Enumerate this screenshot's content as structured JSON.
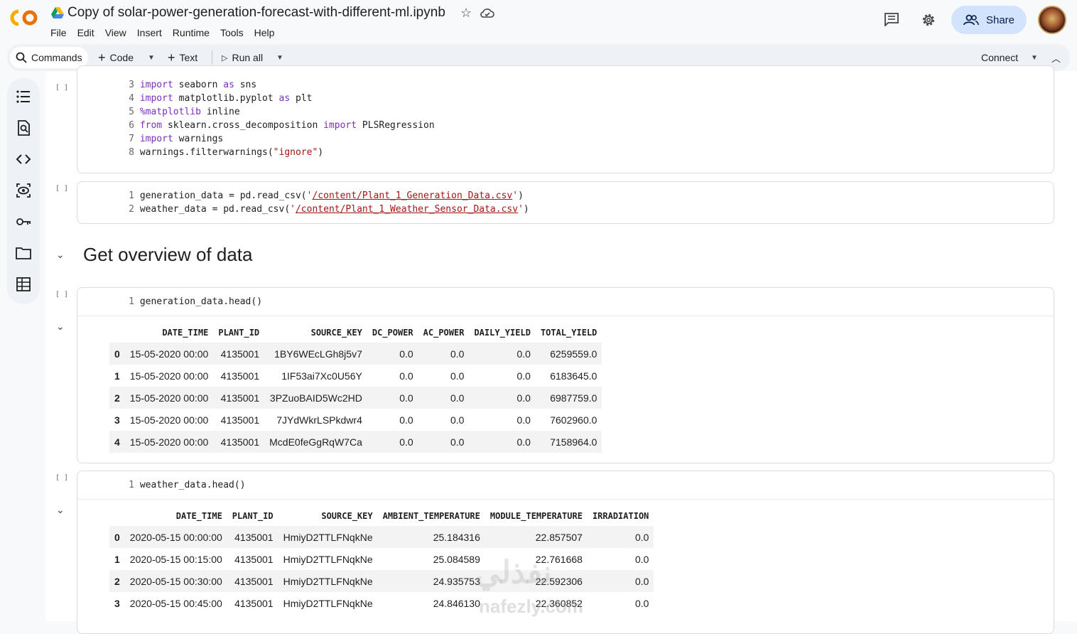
{
  "app": {
    "logo_text": "CO",
    "title": "Copy of solar-power-generation-forecast-with-different-ml.ipynb",
    "menu": [
      "File",
      "Edit",
      "View",
      "Insert",
      "Runtime",
      "Tools",
      "Help"
    ],
    "share_label": "Share"
  },
  "toolbar": {
    "commands_label": "Commands",
    "code_label": "Code",
    "text_label": "Text",
    "run_all_label": "Run all",
    "connect_label": "Connect"
  },
  "cells": {
    "cell1": {
      "bracket": "[ ]",
      "lines": [
        {
          "n": "3",
          "parts": [
            [
              "kw",
              "import"
            ],
            [
              "",
              " seaborn "
            ],
            [
              "kw",
              "as"
            ],
            [
              "",
              " sns"
            ]
          ]
        },
        {
          "n": "4",
          "parts": [
            [
              "kw",
              "import"
            ],
            [
              "",
              " matplotlib.pyplot "
            ],
            [
              "kw",
              "as"
            ],
            [
              "",
              " plt"
            ]
          ]
        },
        {
          "n": "5",
          "parts": [
            [
              "kw",
              "%matplotlib"
            ],
            [
              "",
              " inline"
            ]
          ]
        },
        {
          "n": "6",
          "parts": [
            [
              "kw",
              "from"
            ],
            [
              "",
              " sklearn.cross_decomposition "
            ],
            [
              "kw",
              "import"
            ],
            [
              "",
              " PLSRegression"
            ]
          ]
        },
        {
          "n": "7",
          "parts": [
            [
              "kw",
              "import"
            ],
            [
              "",
              " warnings"
            ]
          ]
        },
        {
          "n": "8",
          "parts": [
            [
              "",
              "warnings.filterwarnings("
            ],
            [
              "str",
              "\"ignore\""
            ],
            [
              "",
              ")"
            ]
          ]
        }
      ]
    },
    "cell2": {
      "bracket": "[ ]",
      "lines": [
        {
          "n": "1",
          "parts": [
            [
              "",
              "generation_data = pd.read_csv("
            ],
            [
              "str",
              "'"
            ],
            [
              "strp",
              "/content/Plant_1_Generation_Data.csv"
            ],
            [
              "str",
              "'"
            ],
            [
              "",
              ")"
            ]
          ]
        },
        {
          "n": "2",
          "parts": [
            [
              "",
              "weather_data = pd.read_csv("
            ],
            [
              "str",
              "'"
            ],
            [
              "strp",
              "/content/Plant_1_Weather_Sensor_Data.csv"
            ],
            [
              "str",
              "'"
            ],
            [
              "",
              ")"
            ]
          ]
        }
      ]
    },
    "heading": "Get overview of data",
    "cell3": {
      "bracket": "[ ]",
      "code_line_no": "1",
      "code": "generation_data.head()",
      "table": {
        "columns": [
          "",
          "DATE_TIME",
          "PLANT_ID",
          "SOURCE_KEY",
          "DC_POWER",
          "AC_POWER",
          "DAILY_YIELD",
          "TOTAL_YIELD"
        ],
        "rows": [
          [
            "0",
            "15-05-2020 00:00",
            "4135001",
            "1BY6WEcLGh8j5v7",
            "0.0",
            "0.0",
            "0.0",
            "6259559.0"
          ],
          [
            "1",
            "15-05-2020 00:00",
            "4135001",
            "1IF53ai7Xc0U56Y",
            "0.0",
            "0.0",
            "0.0",
            "6183645.0"
          ],
          [
            "2",
            "15-05-2020 00:00",
            "4135001",
            "3PZuoBAID5Wc2HD",
            "0.0",
            "0.0",
            "0.0",
            "6987759.0"
          ],
          [
            "3",
            "15-05-2020 00:00",
            "4135001",
            "7JYdWkrLSPkdwr4",
            "0.0",
            "0.0",
            "0.0",
            "7602960.0"
          ],
          [
            "4",
            "15-05-2020 00:00",
            "4135001",
            "McdE0feGgRqW7Ca",
            "0.0",
            "0.0",
            "0.0",
            "7158964.0"
          ]
        ]
      }
    },
    "cell4": {
      "bracket": "[ ]",
      "code_line_no": "1",
      "code": "weather_data.head()",
      "table": {
        "columns": [
          "",
          "DATE_TIME",
          "PLANT_ID",
          "SOURCE_KEY",
          "AMBIENT_TEMPERATURE",
          "MODULE_TEMPERATURE",
          "IRRADIATION"
        ],
        "rows": [
          [
            "0",
            "2020-05-15 00:00:00",
            "4135001",
            "HmiyD2TTLFNqkNe",
            "25.184316",
            "22.857507",
            "0.0"
          ],
          [
            "1",
            "2020-05-15 00:15:00",
            "4135001",
            "HmiyD2TTLFNqkNe",
            "25.084589",
            "22.761668",
            "0.0"
          ],
          [
            "2",
            "2020-05-15 00:30:00",
            "4135001",
            "HmiyD2TTLFNqkNe",
            "24.935753",
            "22.592306",
            "0.0"
          ],
          [
            "3",
            "2020-05-15 00:45:00",
            "4135001",
            "HmiyD2TTLFNqkNe",
            "24.846130",
            "22.360852",
            "0.0"
          ]
        ]
      }
    }
  },
  "watermark": {
    "line1": "نفذلي",
    "line2": "nafezly.com"
  },
  "colors": {
    "keyword": "#7b2fbe",
    "string": "#a31515",
    "share_bg": "#d3e3fd"
  }
}
